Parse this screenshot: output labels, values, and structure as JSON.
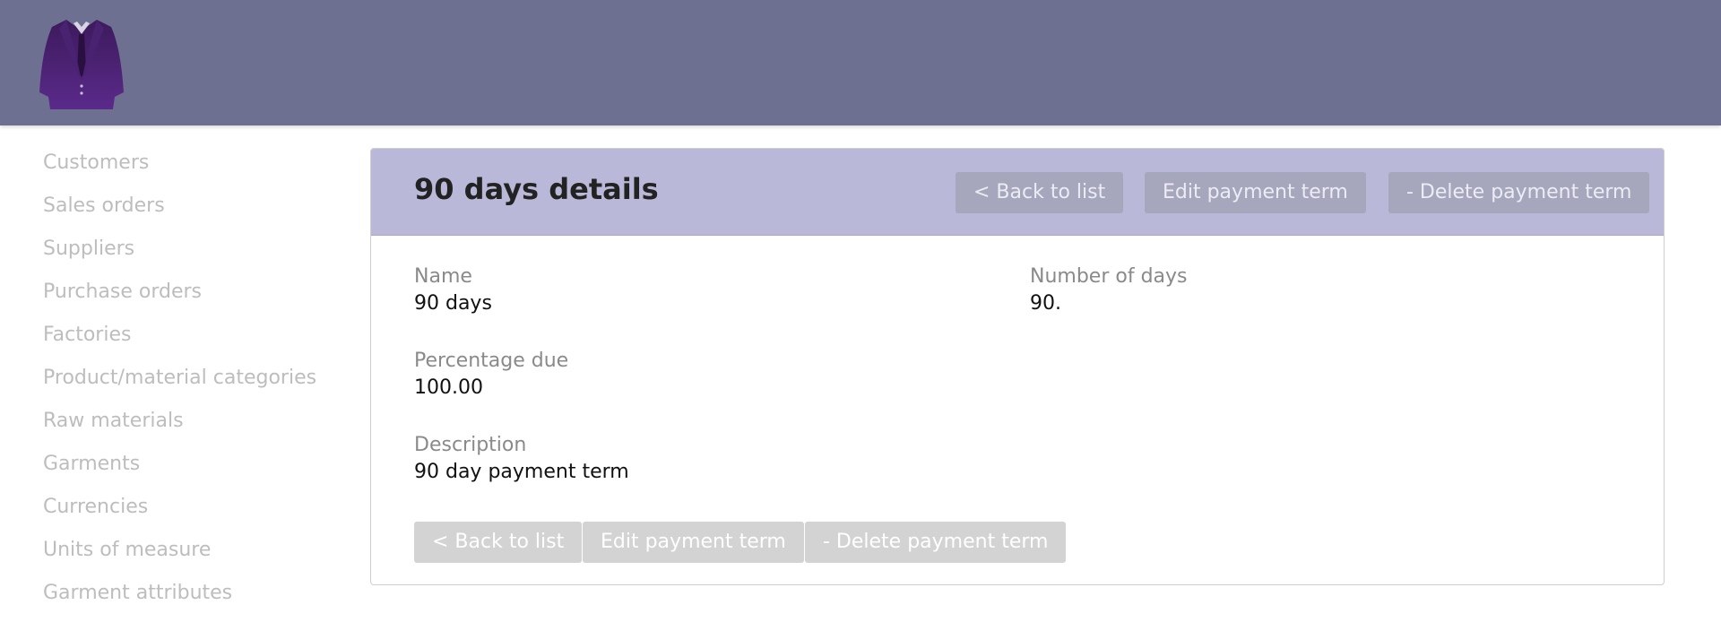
{
  "brand": {
    "logo_icon": "suit-jacket-icon",
    "header_color": "#6d7090"
  },
  "sidebar": {
    "items": [
      {
        "label": "Customers"
      },
      {
        "label": "Sales orders"
      },
      {
        "label": "Suppliers"
      },
      {
        "label": "Purchase orders"
      },
      {
        "label": "Factories"
      },
      {
        "label": "Product/material categories"
      },
      {
        "label": "Raw materials"
      },
      {
        "label": "Garments"
      },
      {
        "label": "Currencies"
      },
      {
        "label": "Units of measure"
      },
      {
        "label": "Garment attributes"
      }
    ]
  },
  "panel": {
    "title": "90 days details",
    "actions": {
      "back_label": "< Back to list",
      "edit_label": "Edit payment term",
      "delete_label": "- Delete payment term"
    },
    "fields": {
      "name": {
        "label": "Name",
        "value": "90 days"
      },
      "number_of_days": {
        "label": "Number of days",
        "value": "90."
      },
      "percentage_due": {
        "label": "Percentage due",
        "value": "100.00"
      },
      "description": {
        "label": "Description",
        "value": "90 day payment term"
      }
    }
  }
}
